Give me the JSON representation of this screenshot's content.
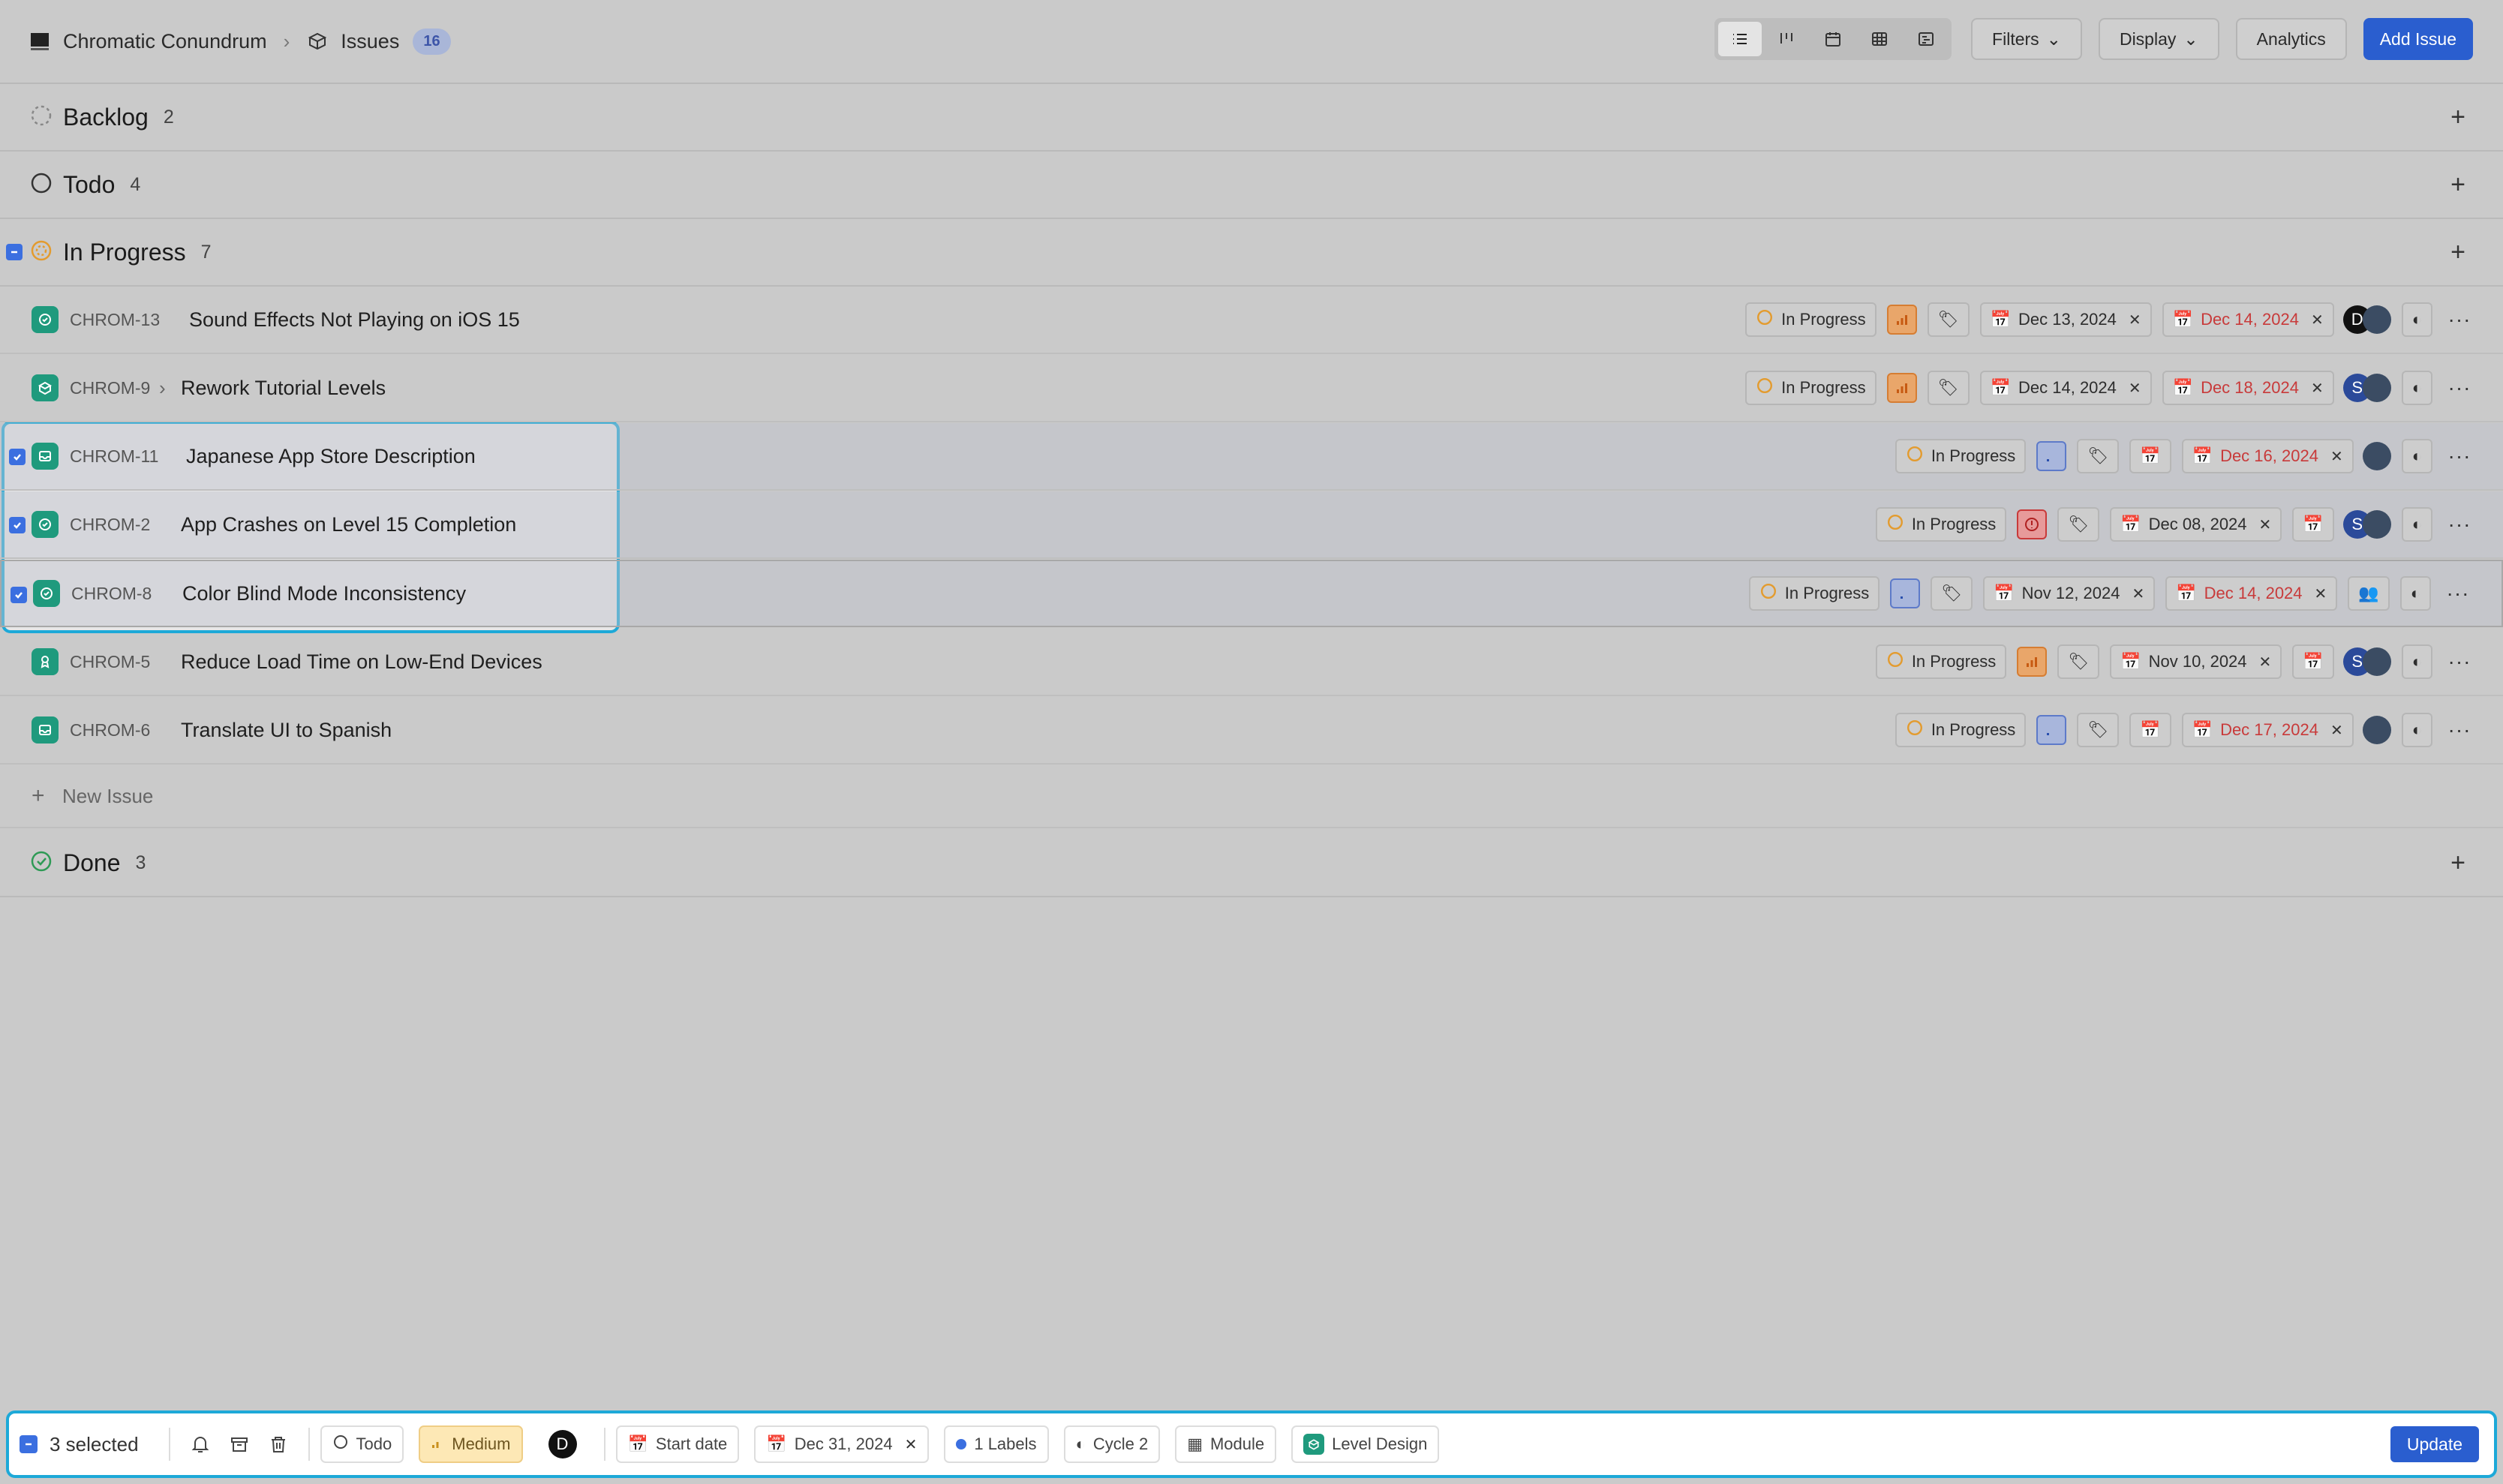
{
  "header": {
    "project": "Chromatic Conundrum",
    "section": "Issues",
    "issue_count": "16",
    "filters_label": "Filters",
    "display_label": "Display",
    "analytics_label": "Analytics",
    "add_issue_label": "Add Issue"
  },
  "groups": {
    "backlog": {
      "name": "Backlog",
      "count": "2"
    },
    "todo": {
      "name": "Todo",
      "count": "4"
    },
    "in_progress": {
      "name": "In Progress",
      "count": "7"
    },
    "done": {
      "name": "Done",
      "count": "3"
    }
  },
  "issues": [
    {
      "id": "CHROM-13",
      "title": "Sound Effects Not Playing on iOS 15",
      "state": "In Progress",
      "start": "Dec 13, 2024",
      "due": "Dec 14, 2024"
    },
    {
      "id": "CHROM-9",
      "title": "Rework Tutorial Levels",
      "state": "In Progress",
      "start": "Dec 14, 2024",
      "due": "Dec 18, 2024"
    },
    {
      "id": "CHROM-11",
      "title": "Japanese App Store Description",
      "state": "In Progress",
      "start": "",
      "due": "Dec 16, 2024"
    },
    {
      "id": "CHROM-2",
      "title": "App Crashes on Level 15 Completion",
      "state": "In Progress",
      "start": "Dec 08, 2024",
      "due": ""
    },
    {
      "id": "CHROM-8",
      "title": "Color Blind Mode Inconsistency",
      "state": "In Progress",
      "start": "Nov 12, 2024",
      "due": "Dec 14, 2024"
    },
    {
      "id": "CHROM-5",
      "title": "Reduce Load Time on Low-End Devices",
      "state": "In Progress",
      "start": "Nov 10, 2024",
      "due": ""
    },
    {
      "id": "CHROM-6",
      "title": "Translate UI to Spanish",
      "state": "In Progress",
      "start": "",
      "due": "Dec 17, 2024"
    }
  ],
  "new_issue_label": "New Issue",
  "avatars": {
    "d": "D",
    "s": "S"
  },
  "bulk": {
    "selected": "3 selected",
    "state": "Todo",
    "priority": "Medium",
    "assignee": "D",
    "start_date": "Start date",
    "due_date": "Dec 31, 2024",
    "labels": "1 Labels",
    "cycle": "Cycle 2",
    "module": "Module",
    "project_label": "Level Design",
    "update_label": "Update"
  },
  "colors": {
    "accent": "#2a5ecf",
    "selection_border": "#1da9d8",
    "issue_icon": "#1f9a7d",
    "due_red": "#c83a3a",
    "priority_orange": "#e07a2e"
  }
}
